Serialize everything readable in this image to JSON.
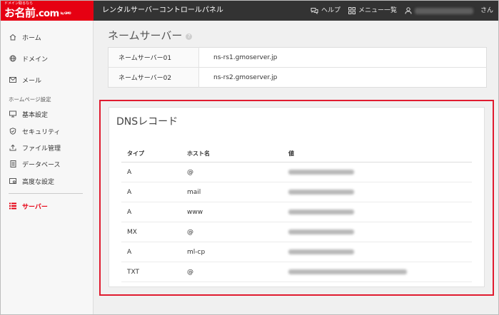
{
  "header": {
    "logo_tagline": "ドメイン取るなら",
    "logo_main": "お名前",
    "logo_com": ".com",
    "logo_sub": "by GMO",
    "title": "レンタルサーバーコントロールパネル",
    "help_label": "ヘルプ",
    "menu_label": "メニュー一覧",
    "user_suffix": "さん"
  },
  "sidebar": {
    "items": [
      {
        "label": "ホーム",
        "icon": "home-icon"
      },
      {
        "label": "ドメイン",
        "icon": "globe-icon"
      },
      {
        "label": "メール",
        "icon": "mail-icon"
      }
    ],
    "section_label": "ホームページ設定",
    "section_items": [
      {
        "label": "基本設定",
        "icon": "monitor-icon"
      },
      {
        "label": "セキュリティ",
        "icon": "shield-icon"
      },
      {
        "label": "ファイル管理",
        "icon": "upload-icon"
      },
      {
        "label": "データベース",
        "icon": "database-icon"
      },
      {
        "label": "高度な設定",
        "icon": "advanced-settings-icon"
      }
    ],
    "active_item": {
      "label": "サーバー",
      "icon": "server-icon"
    }
  },
  "nameserver": {
    "title": "ネームサーバー",
    "help_glyph": "?",
    "rows": [
      {
        "key": "ネームサーバー01",
        "value": "ns-rs1.gmoserver.jp"
      },
      {
        "key": "ネームサーバー02",
        "value": "ns-rs2.gmoserver.jp"
      }
    ]
  },
  "dns": {
    "title": "DNSレコード",
    "columns": [
      "タイプ",
      "ホスト名",
      "値"
    ],
    "rows": [
      {
        "type": "A",
        "host": "@"
      },
      {
        "type": "A",
        "host": "mail"
      },
      {
        "type": "A",
        "host": "www"
      },
      {
        "type": "MX",
        "host": "@"
      },
      {
        "type": "A",
        "host": "ml-cp"
      },
      {
        "type": "TXT",
        "host": "@"
      }
    ]
  },
  "colors": {
    "brand_red": "#e60012",
    "header_bg": "#333333",
    "highlight_border": "#e01b2f"
  }
}
